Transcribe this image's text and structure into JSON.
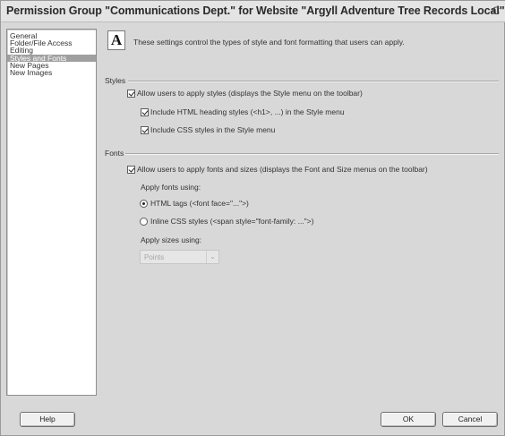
{
  "window": {
    "title": "Permission Group \"Communications Dept.\" for Website \"Argyll Adventure Tree Records Local\"",
    "close_glyph": "C"
  },
  "sidebar": {
    "items": [
      {
        "label": "General",
        "selected": false
      },
      {
        "label": "Folder/File Access",
        "selected": false
      },
      {
        "label": "Editing",
        "selected": false
      },
      {
        "label": "Styles and Fonts",
        "selected": true
      },
      {
        "label": "New Pages",
        "selected": false
      },
      {
        "label": "New Images",
        "selected": false
      }
    ]
  },
  "content": {
    "icon_letter": "A",
    "description": "These settings control the types of style and font formatting that users can apply.",
    "styles": {
      "label": "Styles",
      "allow_label": "Allow users to apply styles (displays the Style menu on the toolbar)",
      "allow_checked": true,
      "html_heading_label": "Include HTML heading styles (<h1>, ...) in the Style menu",
      "html_heading_checked": true,
      "css_label": "Include CSS styles in the Style menu",
      "css_checked": true
    },
    "fonts": {
      "label": "Fonts",
      "allow_label": "Allow users to apply fonts and sizes (displays the Font and Size menus on the toolbar)",
      "allow_checked": true,
      "apply_fonts_label": "Apply fonts using:",
      "html_tags_label": "HTML tags (<font face=\"...\">)",
      "html_tags_selected": true,
      "inline_css_label": "Inline CSS styles (<span style=\"font-family: ...\">)",
      "inline_css_selected": false,
      "apply_sizes_label": "Apply sizes using:",
      "sizes_select_value": "Points",
      "sizes_select_arrow": "⌄"
    }
  },
  "buttons": {
    "help": "Help",
    "ok": "OK",
    "cancel": "Cancel"
  }
}
